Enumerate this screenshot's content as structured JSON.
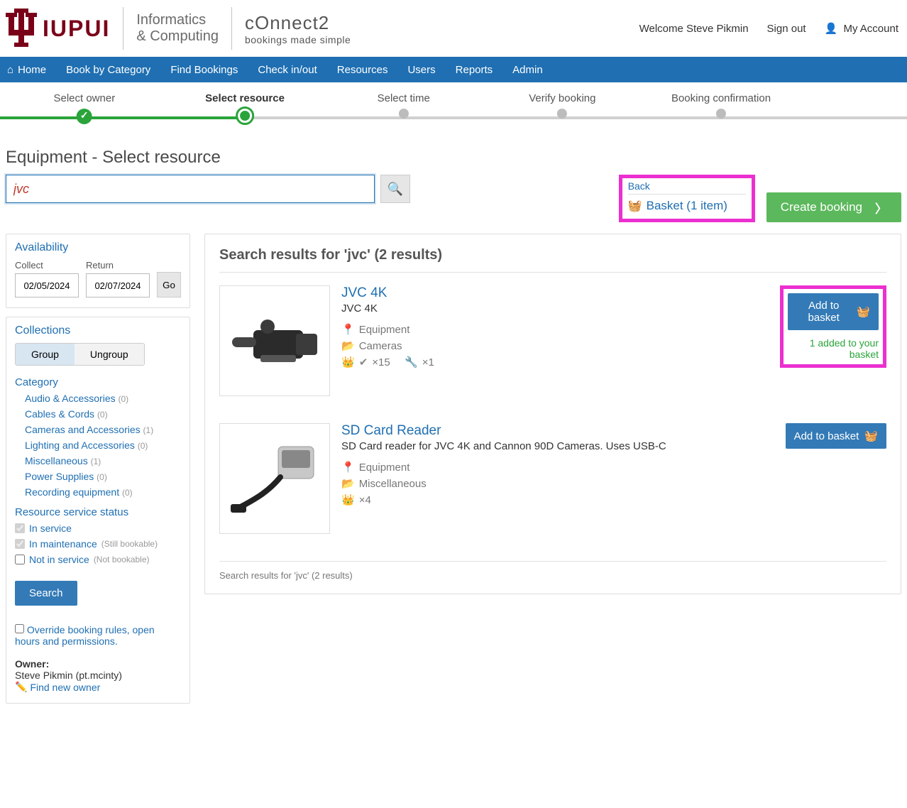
{
  "header": {
    "brand_text": "IUPUI",
    "sub_brand_line1": "Informatics",
    "sub_brand_line2": "& Computing",
    "connect2_top": "cOnnect2",
    "connect2_sub": "bookings made simple",
    "welcome": "Welcome Steve Pikmin",
    "sign_out": "Sign out",
    "my_account": "My Account"
  },
  "nav": {
    "home": "Home",
    "book_by_category": "Book by Category",
    "find_bookings": "Find Bookings",
    "check_in_out": "Check in/out",
    "resources": "Resources",
    "users": "Users",
    "reports": "Reports",
    "admin": "Admin"
  },
  "wizard": {
    "steps": [
      "Select owner",
      "Select resource",
      "Select time",
      "Verify booking",
      "Booking confirmation"
    ]
  },
  "page": {
    "title": "Equipment - Select resource",
    "search_value": "jvc",
    "back_label": "Back",
    "basket_label": "Basket (1 item)",
    "create_booking": "Create booking"
  },
  "sidebar": {
    "availability_title": "Availability",
    "collect_label": "Collect",
    "return_label": "Return",
    "collect_value": "02/05/2024",
    "return_value": "02/07/2024",
    "go_label": "Go",
    "collections_title": "Collections",
    "group_label": "Group",
    "ungroup_label": "Ungroup",
    "category_title": "Category",
    "categories": [
      {
        "name": "Audio & Accessories",
        "count": "(0)"
      },
      {
        "name": "Cables & Cords",
        "count": "(0)"
      },
      {
        "name": "Cameras and Accessories",
        "count": "(1)"
      },
      {
        "name": "Lighting and Accessories",
        "count": "(0)"
      },
      {
        "name": "Miscellaneous",
        "count": "(1)"
      },
      {
        "name": "Power Supplies",
        "count": "(0)"
      },
      {
        "name": "Recording equipment",
        "count": "(0)"
      }
    ],
    "status_title": "Resource service status",
    "in_service": "In service",
    "in_maintenance": "In maintenance",
    "in_maintenance_hint": "(Still bookable)",
    "not_in_service": "Not in service",
    "not_in_service_hint": "(Not bookable)",
    "search_button": "Search",
    "override_label": "Override booking rules, open hours and permissions.",
    "owner_label": "Owner:",
    "owner_name": "Steve Pikmin (pt.mcinty)",
    "find_new_owner": "Find new owner"
  },
  "results": {
    "title": "Search results for 'jvc' (2 results)",
    "footer": "Search results for 'jvc' (2 results)",
    "items": [
      {
        "name": "JVC 4K",
        "desc": "JVC 4K",
        "loc": "Equipment",
        "cat": "Cameras",
        "avail_count": "×15",
        "tool_count": "×1",
        "add_label": "Add to basket",
        "added_msg": "1 added to your basket",
        "highlighted": true
      },
      {
        "name": "SD Card Reader",
        "desc": "SD Card reader for JVC 4K and Cannon 90D Cameras. Uses USB-C",
        "loc": "Equipment",
        "cat": "Miscellaneous",
        "avail_count": "×4",
        "tool_count": "",
        "add_label": "Add to basket",
        "added_msg": "",
        "highlighted": false
      }
    ]
  }
}
